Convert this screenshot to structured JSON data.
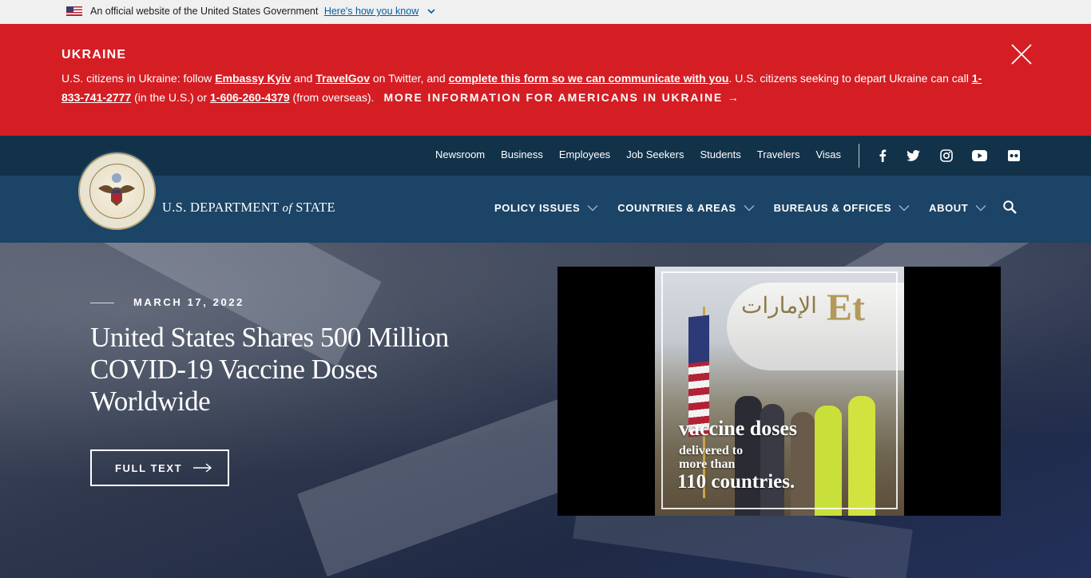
{
  "gov_banner": {
    "text": "An official website of the United States Government",
    "link": "Here's how you know"
  },
  "alert": {
    "title": "UKRAINE",
    "t1": "U.S. citizens in Ukraine: follow ",
    "link_embassy": "Embassy Kyiv",
    "t2": " and ",
    "link_travelgov": "TravelGov",
    "t3": " on Twitter, and ",
    "link_form": "complete this form so we can communicate with you",
    "t4": ". U.S. citizens seeking to depart Ukraine can call ",
    "phone_us": "1-833-741-2777",
    "t5": " (in the U.S.) or ",
    "phone_overseas": "1-606-260-4379",
    "t6": " (from overseas).",
    "more_link": "MORE INFORMATION FOR AMERICANS IN UKRAINE →"
  },
  "utility_nav": [
    "Newsroom",
    "Business",
    "Employees",
    "Job Seekers",
    "Students",
    "Travelers",
    "Visas"
  ],
  "social_icons": [
    "facebook-icon",
    "twitter-icon",
    "instagram-icon",
    "youtube-icon",
    "flickr-icon"
  ],
  "brand": {
    "name_pre": "U.S. DEPARTMENT ",
    "name_of": "of",
    "name_post": " STATE"
  },
  "main_nav": [
    "POLICY ISSUES",
    "COUNTRIES & AREAS",
    "BUREAUS & OFFICES",
    "ABOUT"
  ],
  "hero": {
    "date": "MARCH 17, 2022",
    "title": "United States Shares 500 Million COVID-19 Vaccine Doses Worldwide",
    "button": "FULL TEXT"
  },
  "video": {
    "line1": "vaccine doses",
    "line2": "delivered to",
    "line3": "more than",
    "line4": "110 countries.",
    "plane_text": "الإمارات",
    "plane_logo": "Et"
  },
  "colors": {
    "alert_red": "#d41e24",
    "utility_navy": "#12324a",
    "mainbar_blue": "#1b4466",
    "gov_banner_gray": "#f0f0f0"
  }
}
